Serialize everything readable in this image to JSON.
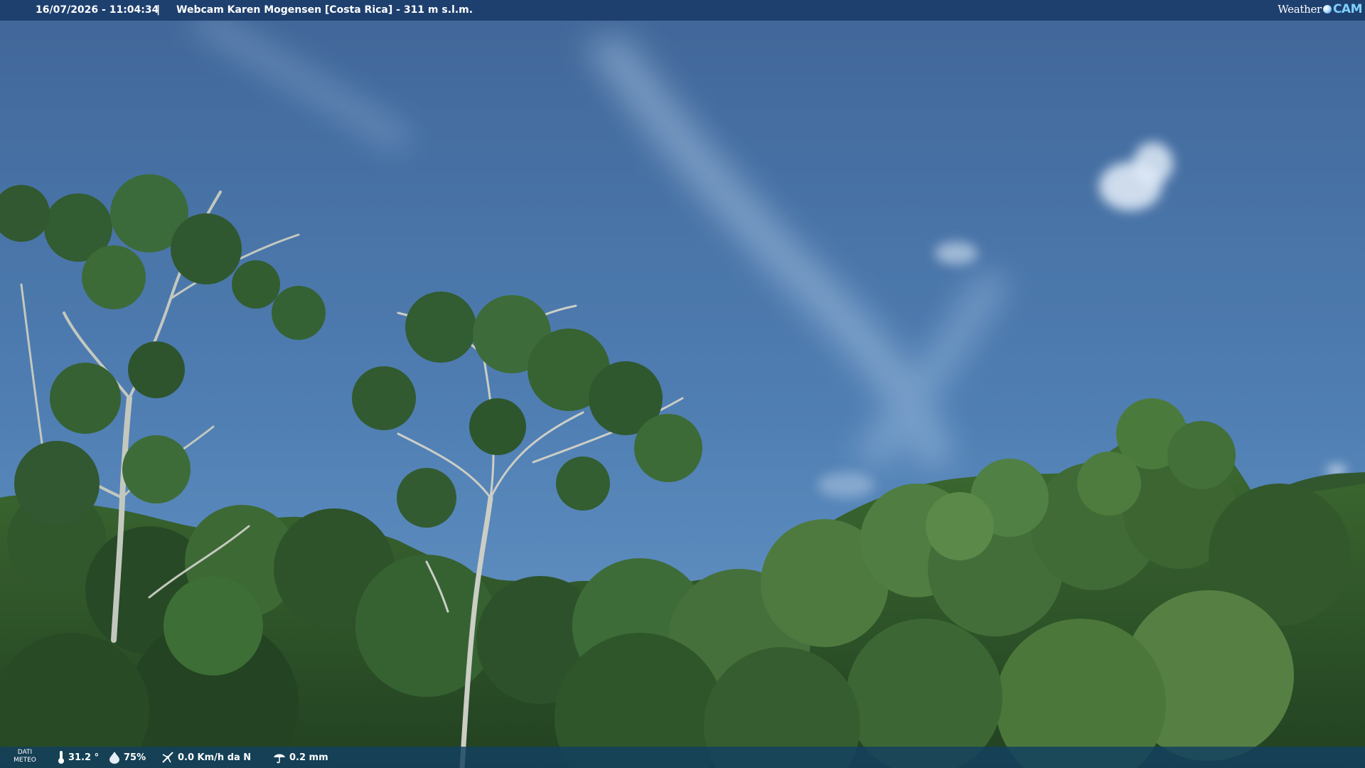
{
  "header": {
    "datetime": "16/07/2026 - 11:04:34",
    "separator": "|",
    "caption": "Webcam Karen Mogensen [Costa Rica]  - 311 m s.l.m."
  },
  "logo": {
    "word": "Weather",
    "cam": "CAM"
  },
  "weather": {
    "label_line1": "DATI",
    "label_line2": "METEO",
    "temperature": "31.2 °",
    "humidity": "75%",
    "wind": "0.0 Km/h da N",
    "rain": "0.2 mm"
  },
  "icons": {
    "temperature": "thermometer-icon",
    "humidity": "humidity-drop-icon",
    "wind": "wind-icon",
    "rain": "rain-icon",
    "logo": "weather-globe-icon"
  },
  "colors": {
    "sky_top": "#3f6597",
    "sky_bottom": "#5c8fc2",
    "foliage_dark": "#1d3a16",
    "foliage_mid": "#3c6a2a",
    "foliage_light": "#6f9a45",
    "topbar": "#1a3a69",
    "bottombar": "#124060",
    "logo_accent": "#7fd0ff"
  }
}
